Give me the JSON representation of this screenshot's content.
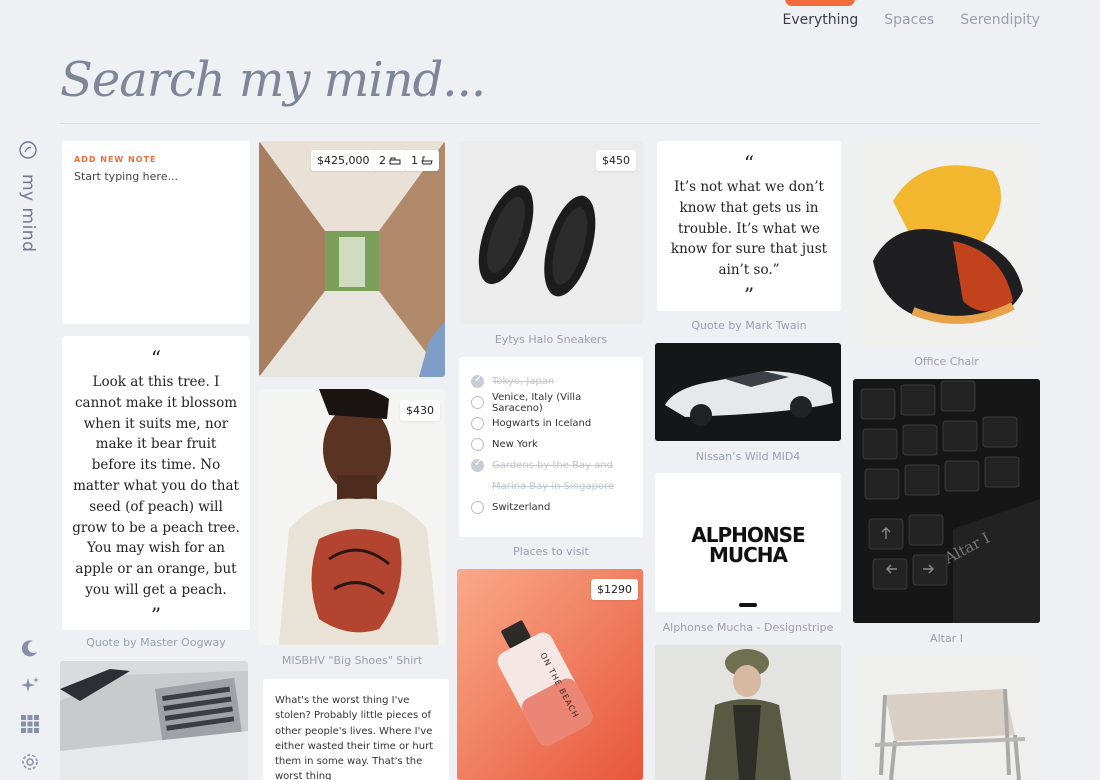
{
  "nav": {
    "tabs": [
      "Everything",
      "Spaces",
      "Serendipity"
    ],
    "active": "Everything"
  },
  "search": {
    "placeholder": "Search my mind..."
  },
  "sidebar": {
    "brand": "my mind",
    "icons": [
      "brain-icon",
      "moon-icon",
      "sparkle-icon",
      "grid-icon",
      "settings-icon"
    ]
  },
  "colors": {
    "accent": "#f26b3a",
    "background": "#eef0f4",
    "muted": "#9aa0ad"
  },
  "cards": {
    "note": {
      "label": "ADD NEW NOTE",
      "placeholder": "Start typing here..."
    },
    "oogway": {
      "quote": "Look at this tree. I cannot make it blossom when it suits me, nor make it bear fruit before its time. No matter what you do that seed (of peach) will grow to be a peach tree. You may wish for an apple or an orange, but you will get a peach.",
      "caption": "Quote by Master Oogway",
      "open_mark": "“",
      "close_mark": "”"
    },
    "house": {
      "price": "$425,000",
      "beds": "2",
      "baths": "1"
    },
    "shirt": {
      "price": "$430",
      "caption": "MISBHV \"Big Shoes\" Shirt"
    },
    "stolen": {
      "text": "What's the worst thing I've stolen? Probably little pieces of other people's lives. Where I've either wasted their time or hurt them in some way. That's the worst thing"
    },
    "sneakers": {
      "price": "$450",
      "caption": "Eytys Halo Sneakers"
    },
    "places": {
      "caption": "Places to visit",
      "items": [
        {
          "label": "Tokyo, Japan",
          "done": true
        },
        {
          "label": "Venice, Italy (Villa Saraceno)",
          "done": false
        },
        {
          "label": "Hogwarts in Iceland",
          "done": false
        },
        {
          "label": "New York",
          "done": false
        },
        {
          "label": "Gardens by the Bay and",
          "done": true
        },
        {
          "label": "Marina Bay in Singapore",
          "done": true
        },
        {
          "label": "Switzerland",
          "done": false
        }
      ]
    },
    "perfume": {
      "price": "$1290",
      "bottle_text": "ON THE BEACH"
    },
    "twain": {
      "quote": "It’s not what we don’t know that gets us in trouble. It’s what we know for sure that just ain’t so.”",
      "caption": "Quote by Mark Twain",
      "open_mark": "“",
      "close_mark": "”"
    },
    "nissan": {
      "caption": "Nissan’s Wild MID4"
    },
    "mucha": {
      "title_line1": "ALPHONSE",
      "title_line2": "MUCHA",
      "caption": "Alphonse Mucha - Designstripe"
    },
    "chair": {
      "caption": "Office Chair"
    },
    "keyboard": {
      "caption": "Altar I",
      "engraving": "Altar I"
    }
  }
}
